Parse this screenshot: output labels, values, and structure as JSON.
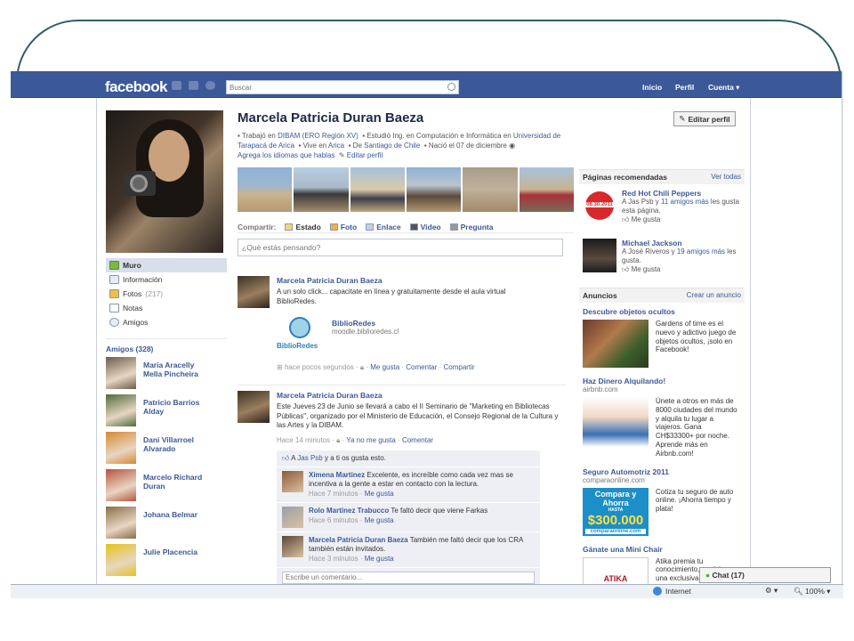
{
  "topbar": {
    "logo": "facebook",
    "search_placeholder": "Buscar",
    "nav": [
      "Inicio",
      "Perfil",
      "Cuenta ▾"
    ]
  },
  "profile": {
    "name": "Marcela Patricia Duran Baeza",
    "edit_button": "Editar perfil",
    "info_line1_pre": "Trabajó en ",
    "info_work": "DIBAM (ERO Región XV)",
    "info_study_pre": "Estudió Ing. en Computación e Informática en ",
    "info_study": "Universidad de Tarapacá de Arica",
    "info_lives_pre": "Vive en ",
    "info_lives": "Arica",
    "info_from_pre": "De ",
    "info_from": "Santiago de Chile",
    "info_born": "Nació el 07 de diciembre",
    "info_lang": "Agrega los idiomas que hablas",
    "info_edit": "Editar perfil"
  },
  "leftnav": {
    "items": [
      {
        "label": "Muro"
      },
      {
        "label": "Información"
      },
      {
        "label": "Fotos",
        "count": "(217)"
      },
      {
        "label": "Notas"
      },
      {
        "label": "Amigos"
      }
    ],
    "friends_title": "Amigos (328)",
    "friends": [
      {
        "name": "María Aracelly Mella Pincheira",
        "color": "#6b5b4a"
      },
      {
        "name": "Patricio Barrios Alday",
        "color": "#4f6b3a"
      },
      {
        "name": "Dani Villarroel Alvarado",
        "color": "#d8892f"
      },
      {
        "name": "Marcelo Richard Duran",
        "color": "#b8533f"
      },
      {
        "name": "Johana Belmar",
        "color": "#8a6e4a"
      },
      {
        "name": "Julie Placencia",
        "color": "#e4c31a"
      }
    ]
  },
  "composer": {
    "share_label": "Compartir:",
    "options": [
      "Estado",
      "Foto",
      "Enlace",
      "Video",
      "Pregunta"
    ],
    "placeholder": "¿Qué estás pensando?"
  },
  "posts": [
    {
      "author": "Marcela Patricia Duran Baeza",
      "text": "A un solo click... capacitate en línea y gratuitamente desde el aula virtual BiblioRedes.",
      "attachment_title": "BiblioRedes",
      "attachment_url": "moodle.biblioredes.cl",
      "attachment_logo": "BiblioRedes",
      "meta_time": "hace pocos segundos",
      "meta_like": "Me gusta",
      "meta_comment": "Comentar",
      "meta_share": "Compartir"
    },
    {
      "author": "Marcela Patricia Duran Baeza",
      "text": "Este Jueves 23 de Junio se llevará a cabo el II Seminario de \"Marketing en Bibliotecas Públicas\", organizado por el Ministerio de Educación, el Consejo Regional de la Cultura y las Artes y la DIBAM.",
      "meta_time": "Hace 14 minutos",
      "meta_like": "Ya no me gusta",
      "meta_comment": "Comentar",
      "likes_pre": "A ",
      "likes_person": "Jas Psb",
      "likes_post": " y a ti os gusta esto.",
      "comments": [
        {
          "author": "Ximena Martinez",
          "text": "Excelente, es increíble como cada vez mas se incentiva a la gente a estar en contacto con la lectura.",
          "time": "Hace 7 minutos",
          "like": "Me gusta"
        },
        {
          "author": "Rolo Martinez Trabucco",
          "text": "Te faltó decir que viene Farkas",
          "time": "Hace 6 minutos",
          "like": "Me gusta"
        },
        {
          "author": "Marcela Patricia Duran Baeza",
          "text": "También me faltó decir que los CRA también están invitados.",
          "time": "Hace 3 minutos",
          "like": "Me gusta"
        }
      ],
      "write_placeholder": "Escribe un comentario..."
    }
  ],
  "sidebar": {
    "recommended_title": "Páginas recomendadas",
    "recommended_link": "Ver todas",
    "recommended": [
      {
        "title": "Red Hot Chili Peppers",
        "text_pre": "A Jas Psb y ",
        "text_link": "11 amigos más",
        "text_post": " les gusta esta página.",
        "like": "Me gusta",
        "badge": "08.30.2011"
      },
      {
        "title": "Michael Jackson",
        "text_pre": "A José Riveros y ",
        "text_link": "19 amigos más",
        "text_post": " les gusta.",
        "like": "Me gusta"
      }
    ],
    "ads_title": "Anuncios",
    "ads_link": "Crear un anuncio",
    "ads": [
      {
        "title": "Descubre objetos ocultos",
        "url": "",
        "text": "Gardens of time es el nuevo y adictivo juego de objetos ocultos, ¡solo en Facebook!"
      },
      {
        "title": "Haz Dinero Alquilando!",
        "url": "airbnb.com",
        "text": "Únete a otros en más de 8000 ciudades del mundo y alquila tu lugar a viajeros. Gana CH$33300+ por noche. Aprende más en Airbnb.com!"
      },
      {
        "title": "Seguro Automotriz 2011",
        "url": "comparaonline.com",
        "text": "Cotiza tu seguro de auto online. ¡Ahorra tiempo y plata!",
        "banner_l1": "Compara y Ahorra",
        "banner_l2": "HASTA",
        "banner_l3": "$300.000",
        "banner_l4": "comparaonline.com"
      },
      {
        "title": "Gánate una Mini Chair",
        "url": "",
        "text": "Atika premia tu conocimiento, participa por una exclusiva",
        "logo": "ATIKA"
      }
    ]
  },
  "chat": {
    "label": "Chat (17)"
  },
  "statusbar": {
    "zone": "Internet",
    "zoom": "100%"
  }
}
